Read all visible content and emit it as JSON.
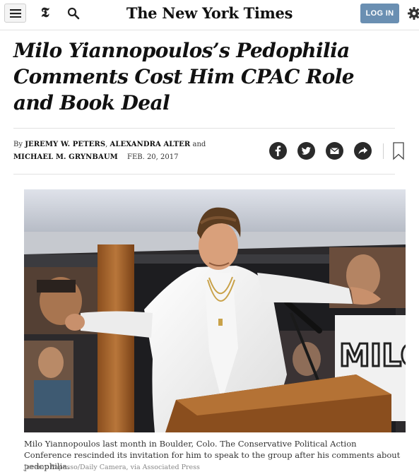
{
  "header": {
    "menu_icon": "hamburger-icon",
    "section_logo": "𝕿",
    "search_icon": "search-icon",
    "masthead": "The New York Times",
    "login_label": "LOG IN",
    "settings_icon": "gear-icon"
  },
  "article": {
    "headline": "Milo Yiannopoulos’s Pedophilia Comments Cost Him CPAC Role and Book Deal",
    "byline": {
      "prefix": "By",
      "author1": "Jeremy W. Peters",
      "sep1": ",",
      "author2": "Alexandra Alter",
      "and": "and",
      "author3": "Michael M. Grynbaum",
      "date": "Feb. 20, 2017"
    },
    "share_icons": [
      "facebook-icon",
      "twitter-icon",
      "email-icon",
      "share-icon",
      "bookmark-icon"
    ],
    "photo": {
      "backdrop_text": "MILO",
      "caption": "Milo Yiannopoulos last month in Boulder, Colo. The Conservative Political Action Conference rescinded its invitation for him to speak to the group after his comments about pedophilia.",
      "credit": "Jeremy Papasso/Daily Camera, via Associated Press"
    }
  },
  "colors": {
    "login_button": "#6a8fb2",
    "share_button": "#2a2a2a",
    "divider": "#e2e2e2"
  }
}
